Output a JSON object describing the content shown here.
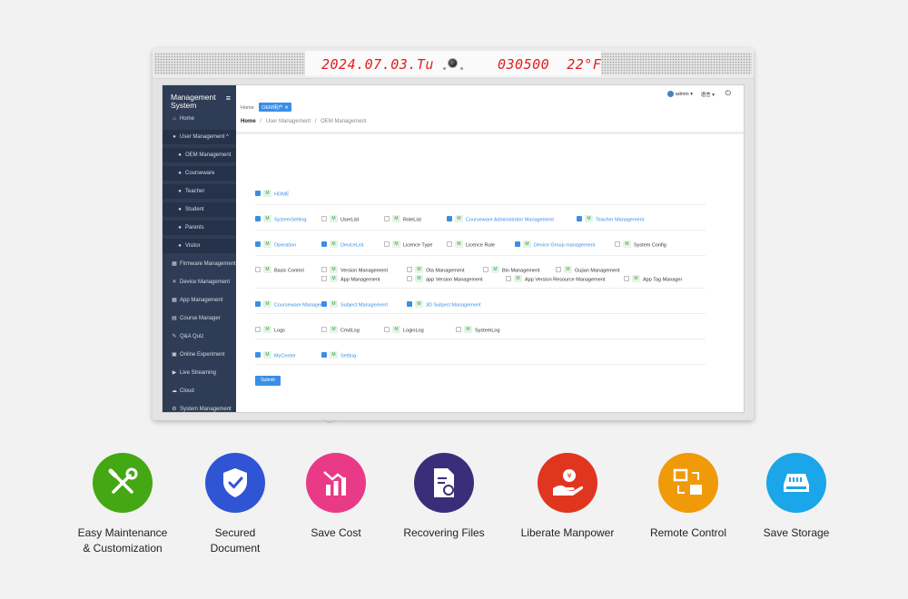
{
  "device": {
    "led_date": "2024.07.03.Tu",
    "led_time": "030500",
    "led_temp": "22°F"
  },
  "app": {
    "brand": "Management System",
    "user": "admin",
    "lang": "语言",
    "tabs": {
      "home": "Home",
      "active": "OEM用户 ✕"
    },
    "breadcrumb": {
      "home": "Home",
      "sep": "/",
      "level1": "User Management",
      "level2": "OEM Management"
    },
    "submit_label": "Submit",
    "m_label": "M"
  },
  "sidebar": {
    "items": [
      {
        "label": "Home",
        "icon": "home-icon"
      },
      {
        "label": "User Management ^",
        "icon": "user-icon"
      },
      {
        "label": "OEM Management",
        "icon": "user-icon"
      },
      {
        "label": "Courseware",
        "icon": "user-icon"
      },
      {
        "label": "Teacher",
        "icon": "user-icon"
      },
      {
        "label": "Student",
        "icon": "user-icon"
      },
      {
        "label": "Parents",
        "icon": "user-icon"
      },
      {
        "label": "Visitor",
        "icon": "user-icon"
      },
      {
        "label": "Firmware Management",
        "icon": "grid-icon"
      },
      {
        "label": "Device Management",
        "icon": "tools-icon"
      },
      {
        "label": "App Management",
        "icon": "grid-icon"
      },
      {
        "label": "Course Manager",
        "icon": "book-icon"
      },
      {
        "label": "Q&A Quiz",
        "icon": "edit-icon"
      },
      {
        "label": "Online Experiment",
        "icon": "monitor-icon"
      },
      {
        "label": "Live Streaming",
        "icon": "video-icon"
      },
      {
        "label": "Cloud",
        "icon": "cloud-icon"
      },
      {
        "label": "System Management",
        "icon": "gear-icon"
      }
    ]
  },
  "permissions": [
    {
      "label": "HOME",
      "checked": true
    },
    {
      "label": "SystemSetting",
      "checked": true
    },
    {
      "label": "UserList",
      "checked": false
    },
    {
      "label": "RoleList",
      "checked": false
    },
    {
      "label": "Courseware Administrator Management",
      "checked": true
    },
    {
      "label": "Teacher Management",
      "checked": true
    },
    {
      "label": "Operation",
      "checked": true
    },
    {
      "label": "DeviceList",
      "checked": true
    },
    {
      "label": "Licence Type",
      "checked": false
    },
    {
      "label": "Licence Rule",
      "checked": false
    },
    {
      "label": "Device Group management",
      "checked": true
    },
    {
      "label": "System Config",
      "checked": false
    },
    {
      "label": "Basic Control",
      "checked": false
    },
    {
      "label": "Version Management",
      "checked": false
    },
    {
      "label": "Ota Management",
      "checked": false
    },
    {
      "label": "Bin Management",
      "checked": false
    },
    {
      "label": "Gujian Management",
      "checked": false
    },
    {
      "label": "App Management",
      "checked": false
    },
    {
      "label": "app Version Management",
      "checked": false
    },
    {
      "label": "App Version Resource Management",
      "checked": false
    },
    {
      "label": "App Tag Manager",
      "checked": false
    },
    {
      "label": "Courseware Manager",
      "checked": true
    },
    {
      "label": "Subject Management",
      "checked": true
    },
    {
      "label": "3D Subject Management",
      "checked": true
    },
    {
      "label": "Logs",
      "checked": false
    },
    {
      "label": "CmdLog",
      "checked": false
    },
    {
      "label": "LoginLog",
      "checked": false
    },
    {
      "label": "SystemLog",
      "checked": false
    },
    {
      "label": "MyCenter",
      "checked": true
    },
    {
      "label": "Setting",
      "checked": true
    }
  ],
  "features": [
    {
      "label": "Easy Maintenance & Customization",
      "color": "#43a813",
      "icon": "wrench-screwdriver-icon"
    },
    {
      "label": "Secured Document",
      "color": "#2f55d4",
      "icon": "shield-check-icon"
    },
    {
      "label": "Save Cost",
      "color": "#e83a86",
      "icon": "cost-chart-icon"
    },
    {
      "label": "Recovering Files",
      "color": "#3a2e7a",
      "icon": "file-restore-icon"
    },
    {
      "label": "Liberate Manpower",
      "color": "#e0361f",
      "icon": "hand-coin-icon"
    },
    {
      "label": "Remote Control",
      "color": "#f09a0a",
      "icon": "remote-screens-icon"
    },
    {
      "label": "Save Storage",
      "color": "#1aa6e8",
      "icon": "storage-drive-icon"
    }
  ]
}
